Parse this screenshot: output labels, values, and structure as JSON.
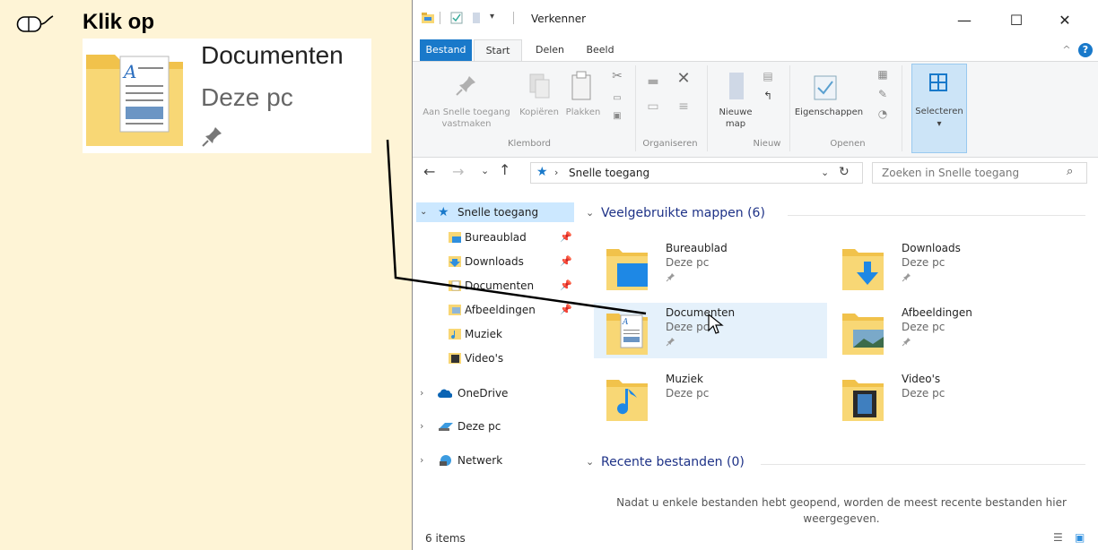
{
  "instruction": {
    "text": "Klik op"
  },
  "zoom": {
    "name": "Documenten",
    "location": "Deze pc"
  },
  "window": {
    "title": "Verkenner",
    "tabs": [
      "Bestand",
      "Start",
      "Delen",
      "Beeld"
    ],
    "ribbon": {
      "pin_label": "Aan Snelle toegang vastmaken",
      "copy_label": "Kopiëren",
      "paste_label": "Plakken",
      "new_folder_label": "Nieuwe map",
      "properties_label": "Eigenschappen",
      "select_label": "Selecteren",
      "groups": [
        "Klembord",
        "Organiseren",
        "Nieuw",
        "Openen"
      ]
    },
    "address": "Snelle toegang",
    "search_placeholder": "Zoeken in Snelle toegang",
    "nav": {
      "quick_access": "Snelle toegang",
      "items": [
        "Bureaublad",
        "Downloads",
        "Documenten",
        "Afbeeldingen",
        "Muziek",
        "Video's"
      ],
      "onedrive": "OneDrive",
      "this_pc": "Deze pc",
      "network": "Netwerk"
    },
    "frequent": {
      "title": "Veelgebruikte mappen (6)",
      "folders": [
        {
          "name": "Bureaublad",
          "location": "Deze pc"
        },
        {
          "name": "Downloads",
          "location": "Deze pc"
        },
        {
          "name": "Documenten",
          "location": "Deze pc"
        },
        {
          "name": "Afbeeldingen",
          "location": "Deze pc"
        },
        {
          "name": "Muziek",
          "location": "Deze pc"
        },
        {
          "name": "Video's",
          "location": "Deze pc"
        }
      ]
    },
    "recent": {
      "title": "Recente bestanden (0)",
      "empty": "Nadat u enkele bestanden hebt geopend, worden de meest recente bestanden hier weergegeven."
    },
    "status": "6 items"
  },
  "colors": {
    "accent": "#1979ca",
    "selection": "#e5f1fb",
    "folder": "#f8d775",
    "background": "#fef4d6"
  }
}
